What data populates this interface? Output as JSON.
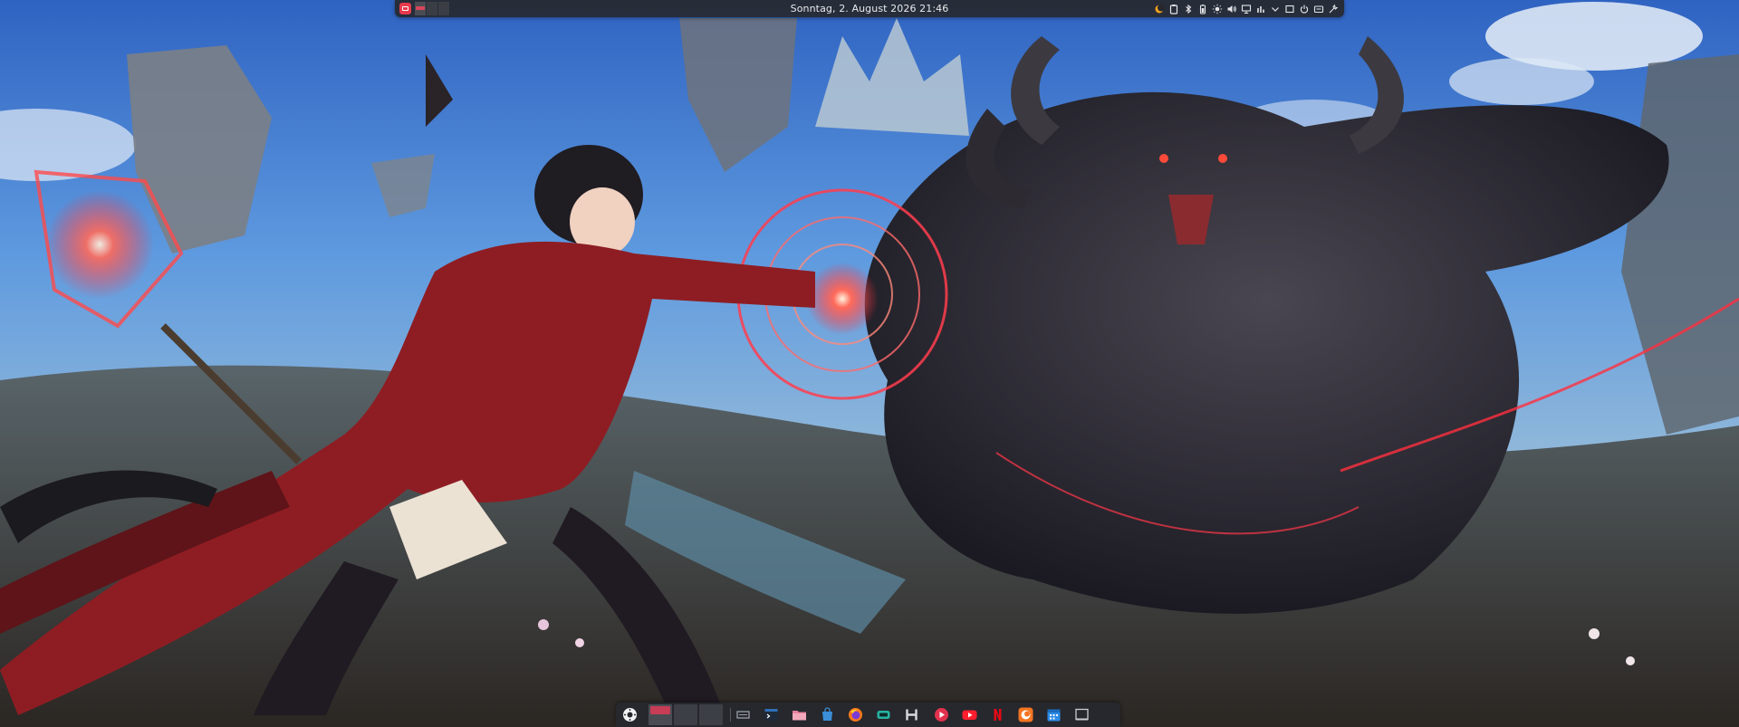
{
  "desktop": {
    "wallpaper_icon": "fantasy-battle-wallpaper"
  },
  "top_panel": {
    "launcher_icon": "app-launcher-icon",
    "pager": {
      "desktops": 3,
      "active_index": 0
    },
    "clock": "Sonntag, 2. August 2026 21:46",
    "tray_icons": [
      "night-light-icon",
      "clipboard-icon",
      "bluetooth-icon",
      "battery-icon",
      "brightness-icon",
      "volume-icon",
      "display-icon",
      "network-icon",
      "show-hidden-chevron-icon",
      "show-desktop-icon",
      "power-icon",
      "settings-icon",
      "tools-icon"
    ]
  },
  "dock": {
    "launcher_icon": "dock-launcher-icon",
    "pager": {
      "desktops": 3,
      "active_index": 0
    },
    "apps": [
      {
        "name": "system-monitor-icon",
        "color": "#9aa0a8"
      },
      {
        "name": "terminal-icon",
        "color": "#2f6fb8"
      },
      {
        "name": "file-manager-icon",
        "color": "#e8829a"
      },
      {
        "name": "store-icon",
        "color": "#3b8fd9"
      },
      {
        "name": "firefox-icon",
        "color": "#ff7a18"
      },
      {
        "name": "game-controller-icon",
        "color": "#26b5a0"
      },
      {
        "name": "h-app-icon",
        "color": "#d8dade"
      },
      {
        "name": "video-player-icon",
        "color": "#e3324d"
      },
      {
        "name": "youtube-icon",
        "color": "#ff1e2d"
      },
      {
        "name": "netflix-icon",
        "color": "#e50914"
      },
      {
        "name": "crunchyroll-icon",
        "color": "#f47521"
      },
      {
        "name": "calendar-icon",
        "color": "#2d8ce6"
      },
      {
        "name": "window-icon",
        "color": "#c9ccd1"
      }
    ]
  },
  "colors": {
    "panel_bg": "#26282e",
    "accent": "#e8394d",
    "clock_text": "#e9e9ec"
  }
}
